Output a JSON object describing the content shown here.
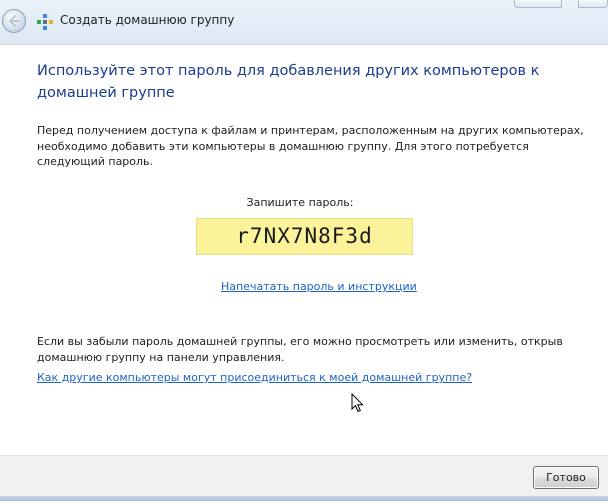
{
  "window": {
    "title": "Создать домашнюю группу"
  },
  "content": {
    "heading": "Используйте этот пароль для добавления других компьютеров к домашней группе",
    "intro": "Перед получением доступа к файлам и принтерам, расположенным на других компьютерах, необходимо добавить эти компьютеры в домашнюю группу. Для этого потребуется следующий пароль.",
    "password_label": "Запишите пароль:",
    "password": "r7NX7N8F3d",
    "print_link": "Напечатать пароль и инструкции",
    "forgot_text": "Если вы забыли пароль домашней группы, его можно просмотреть или изменить, открыв домашнюю группу на панели управления.",
    "how_link": "Как другие компьютеры могут присоединиться к моей домашней группе?"
  },
  "footer": {
    "done_label": "Готово"
  },
  "icons": {
    "back": "back-arrow-icon",
    "homegroup": "homegroup-icon",
    "cursor": "mouse-pointer-icon"
  },
  "colors": {
    "heading": "#1a3d8f",
    "link": "#1c63c4",
    "password_bg": "#fbf39a",
    "footer_bg": "#f0f0f0"
  }
}
